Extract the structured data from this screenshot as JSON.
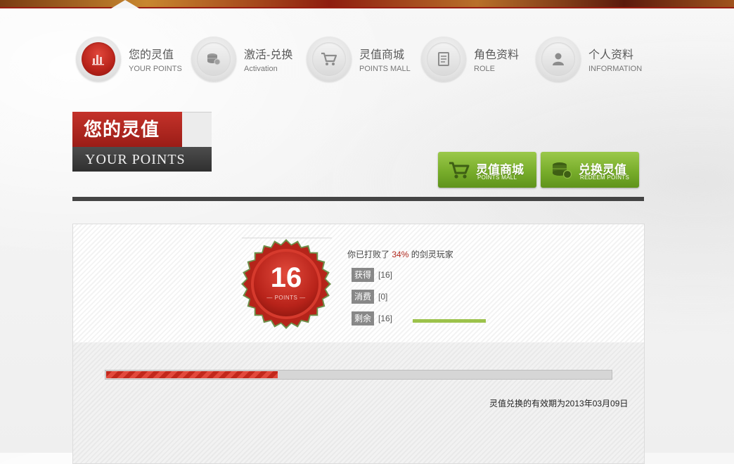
{
  "nav": {
    "items": [
      {
        "cn": "您的灵值",
        "en": "YOUR POINTS",
        "icon": "bar-chart-icon",
        "active": true
      },
      {
        "cn": "激活-兑换",
        "en": "Activation",
        "icon": "coins-icon",
        "active": false
      },
      {
        "cn": "灵值商城",
        "en": "POINTS MALL",
        "icon": "cart-icon",
        "active": false
      },
      {
        "cn": "角色资料",
        "en": "ROLE",
        "icon": "document-icon",
        "active": false
      },
      {
        "cn": "个人资料",
        "en": "INFORMATION",
        "icon": "user-icon",
        "active": false
      }
    ]
  },
  "section": {
    "title_cn": "您的灵值",
    "title_en": "YOUR POINTS"
  },
  "buttons": {
    "mall": {
      "cn": "灵值商城",
      "en": "POINTS MALL",
      "icon": "cart-icon"
    },
    "redeem": {
      "cn": "兑换灵值",
      "en": "REDEEM POINTS",
      "icon": "coins-icon"
    }
  },
  "points": {
    "total": "16",
    "unit": "— POINTS —",
    "summary_prefix": "你已打败了 ",
    "summary_pct": "34%",
    "summary_suffix": " 的剑灵玩家",
    "stats": [
      {
        "label": "获得",
        "value": "[16]"
      },
      {
        "label": "消费",
        "value": "[0]"
      },
      {
        "label": "剩余",
        "value": "[16]"
      }
    ],
    "remaining_fraction": 1.0,
    "progress_fraction": 0.34,
    "expiry_text": "灵值兑换的有效期为2013年03月09日"
  },
  "colors": {
    "accent_red": "#b2281e",
    "accent_green": "#78ad2b",
    "dark_bar": "#444444"
  }
}
